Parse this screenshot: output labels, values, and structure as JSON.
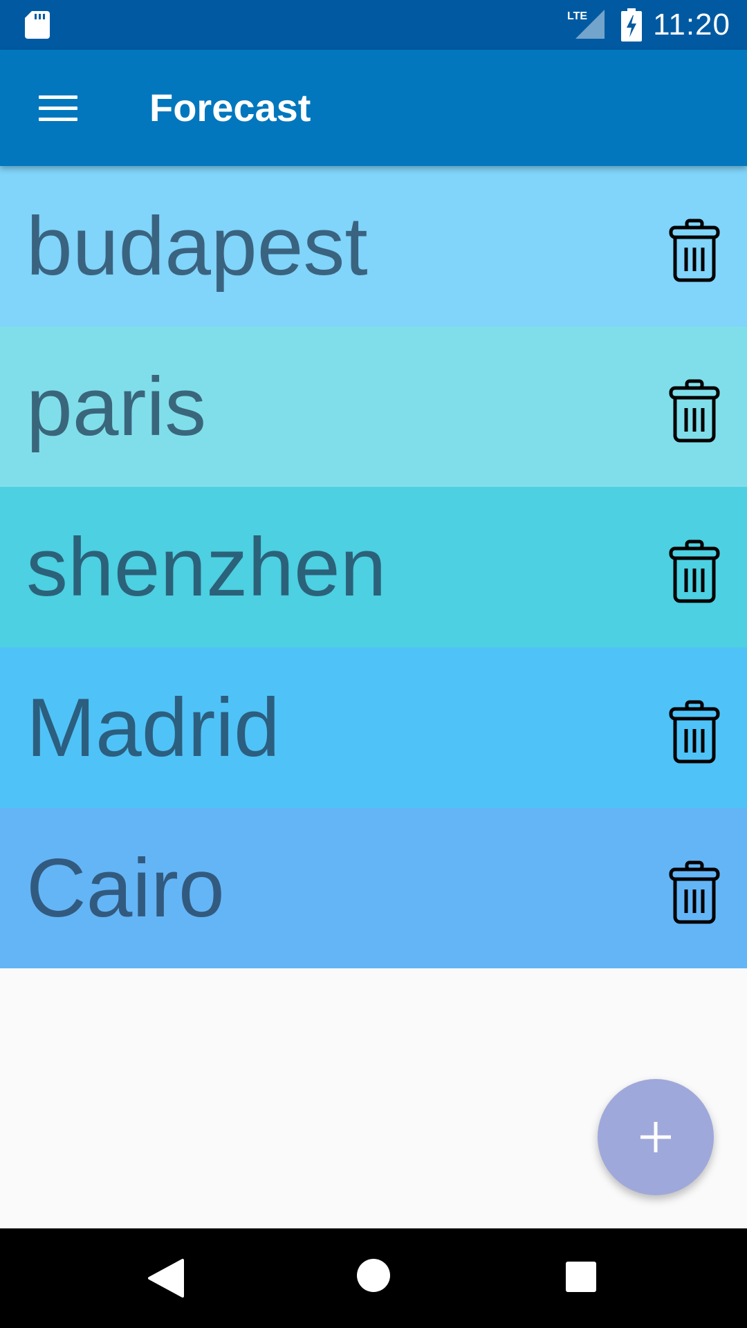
{
  "status_bar": {
    "time": "11:20",
    "network": "LTE",
    "icons": [
      "sd-card-icon",
      "lte-signal-icon",
      "battery-charging-icon"
    ]
  },
  "app_bar": {
    "title": "Forecast",
    "menu_icon": "hamburger-menu-icon"
  },
  "cities": [
    {
      "name": "budapest",
      "color": "#81d4fa",
      "delete_icon": "trash-icon"
    },
    {
      "name": "paris",
      "color": "#80deea",
      "delete_icon": "trash-icon"
    },
    {
      "name": "shenzhen",
      "color": "#4dd0e1",
      "delete_icon": "trash-icon"
    },
    {
      "name": "Madrid",
      "color": "#4fc3f7",
      "delete_icon": "trash-icon"
    },
    {
      "name": "Cairo",
      "color": "#64b5f6",
      "delete_icon": "trash-icon"
    }
  ],
  "fab": {
    "icon": "plus-icon",
    "color": "#9fa8da"
  },
  "nav_bar": {
    "icons": [
      "back-icon",
      "home-icon",
      "recents-icon"
    ]
  },
  "colors": {
    "status_bar": "#015aa1",
    "app_bar": "#0277bd",
    "background": "#fafafa"
  }
}
